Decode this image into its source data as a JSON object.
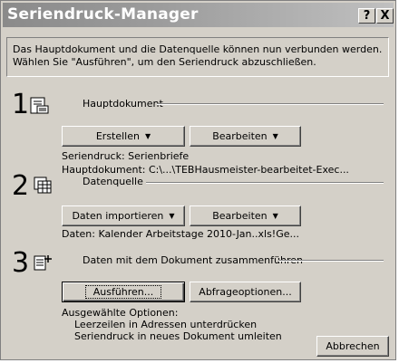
{
  "window": {
    "title": "Seriendruck-Manager",
    "help_label": "?",
    "close_label": "X"
  },
  "intro": {
    "line1": "Das Hauptdokument und die Datenquelle können nun verbunden werden.",
    "line2": "Wählen Sie \"Ausführen\", um den Seriendruck abzuschließen."
  },
  "step1": {
    "number": "1",
    "icon": "main-document-icon",
    "title": "Hauptdokument",
    "create_label": "Erstellen",
    "edit_label": "Bearbeiten",
    "merge_type": "Seriendruck: Serienbriefe",
    "main_doc": "Hauptdokument: C:\\...\\TEBHausmeister-bearbeitet-Exec..."
  },
  "step2": {
    "number": "2",
    "icon": "data-source-icon",
    "title": "Datenquelle",
    "import_label": "Daten importieren",
    "edit_label": "Bearbeiten",
    "data_info": "Daten: Kalender Arbeitstage 2010-Jan..xls!Ge..."
  },
  "step3": {
    "number": "3",
    "icon": "merge-icon",
    "title": "Daten mit dem Dokument zusammenführen",
    "run_label": "Ausführen...",
    "query_label": "Abfrageoptionen...",
    "options_title": "Ausgewählte Optionen:",
    "option1": "Leerzeilen in Adressen unterdrücken",
    "option2": "Seriendruck in neues Dokument umleiten"
  },
  "footer": {
    "cancel_label": "Abbrechen"
  }
}
